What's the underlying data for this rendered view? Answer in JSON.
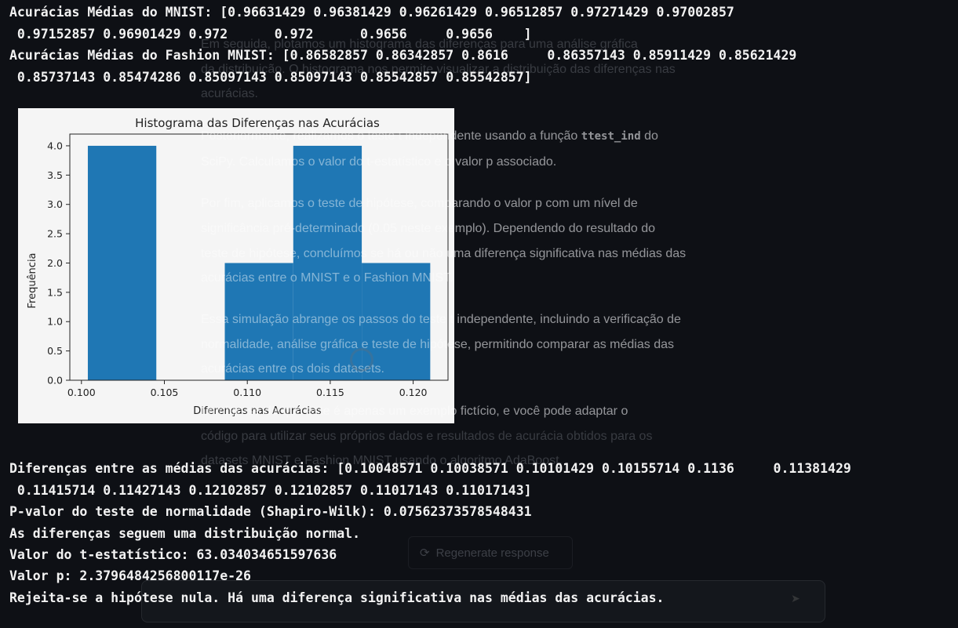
{
  "console": {
    "lines": [
      "Acurácias Médias do MNIST: [0.96631429 0.96381429 0.96261429 0.96512857 0.97271429 0.97002857",
      " 0.97152857 0.96901429 0.972      0.972      0.9656     0.9656    ]",
      "Acurácias Médias do Fashion MNIST: [0.86582857 0.86342857 0.8616     0.86357143 0.85911429 0.85621429",
      " 0.85737143 0.85474286 0.85097143 0.85097143 0.85542857 0.85542857]",
      "Diferenças entre as médias das acurácias: [0.10048571 0.10038571 0.10101429 0.10155714 0.1136     0.11381429",
      " 0.11415714 0.11427143 0.12102857 0.12102857 0.11017143 0.11017143]",
      "P-valor do teste de normalidade (Shapiro-Wilk): 0.07562373578548431",
      "As diferenças seguem uma distribuição normal.",
      "Valor do t-estatístico: 63.034034651597636",
      "Valor p: 2.3796484256800117e-26",
      "Rejeita-se a hipótese nula. Há uma diferença significativa nas médias das acurácias."
    ]
  },
  "background_chat": {
    "lines": [
      "Em seguida, plotamos um histograma das diferenças para uma análise gráfica",
      "da distribuição. O histograma nos permite visualizar a distribuição das diferenças nas",
      "acurácias.",
      "Posteriormente, realizamos o teste t independente usando a função",
      "ttest_ind",
      "do",
      "SciPy. Calculamos o valor do t-estatístico e o valor p associado.",
      "Por fim, aplicamos o teste de hipótese, comparando o valor p com um nível de",
      "significância pré-determinado (0.05 neste exemplo). Dependendo do resultado do",
      "teste de hipótese, concluímos se há ou não uma diferença significativa nas médias das",
      "acurácias entre o MNIST e o Fashion MNIST.",
      "Essa simulação abrange os passos do teste t independente, incluindo a verificação de",
      "normalidade, análise gráfica e teste de hipótese, permitindo comparar as médias das",
      "acurácias entre os dois datasets.",
      "Lembre-se de que este é apenas um exemplo fictício, e você pode adaptar o",
      "código para utilizar seus próprios dados e resultados de acurácia obtidos para os",
      "datasets MNIST e Fashion MNIST usando o algoritmo AdaBoost."
    ],
    "regenerate_label": "Regenerate response"
  },
  "chart_data": {
    "type": "bar",
    "title": "Histograma das Diferenças nas Acurácias",
    "xlabel": "Diferenças nas Acurácias",
    "ylabel": "Frequência",
    "bins": [
      {
        "x0": 0.10038571,
        "x1": 0.10451428,
        "value": 4
      },
      {
        "x0": 0.10451428,
        "x1": 0.10864285,
        "value": 0
      },
      {
        "x0": 0.10864285,
        "x1": 0.11277142,
        "value": 2
      },
      {
        "x0": 0.11277142,
        "x1": 0.1169,
        "value": 4
      },
      {
        "x0": 0.1169,
        "x1": 0.12102857,
        "value": 2
      }
    ],
    "xlim": [
      0.0993,
      0.1221
    ],
    "ylim": [
      0,
      4.2
    ],
    "xticks": [
      0.1,
      0.105,
      0.11,
      0.115,
      0.12
    ],
    "xtick_labels": [
      "0.100",
      "0.105",
      "0.110",
      "0.115",
      "0.120"
    ],
    "yticks": [
      0.0,
      0.5,
      1.0,
      1.5,
      2.0,
      2.5,
      3.0,
      3.5,
      4.0
    ],
    "ytick_labels": [
      "0.0",
      "0.5",
      "1.0",
      "1.5",
      "2.0",
      "2.5",
      "3.0",
      "3.5",
      "4.0"
    ],
    "bar_color": "#1f77b4",
    "grid": false
  }
}
